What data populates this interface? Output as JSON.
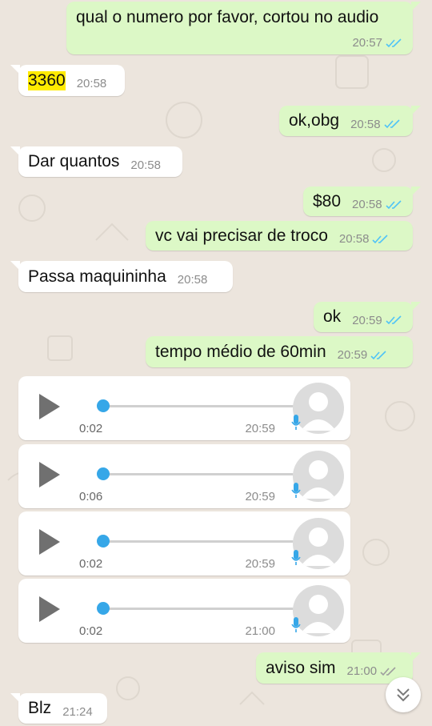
{
  "messages": [
    {
      "text": "qual o numero por favor, cortou no audio",
      "time": "20:57"
    },
    {
      "text": "3360",
      "time": "20:58"
    },
    {
      "text": "ok,obg",
      "time": "20:58"
    },
    {
      "text": "Dar quantos",
      "time": "20:58"
    },
    {
      "text": "$80",
      "time": "20:58"
    },
    {
      "text": "vc vai precisar de troco",
      "time": "20:58"
    },
    {
      "text": "Passa maquininha",
      "time": "20:58"
    },
    {
      "text": "ok",
      "time": "20:59"
    },
    {
      "text": "tempo médio de 60min",
      "time": "20:59"
    },
    {
      "text": "aviso sim",
      "time": "21:00"
    },
    {
      "text": "Blz",
      "time": "21:24"
    }
  ],
  "voice_notes": [
    {
      "duration": "0:02",
      "time": "20:59"
    },
    {
      "duration": "0:06",
      "time": "20:59"
    },
    {
      "duration": "0:02",
      "time": "20:59"
    },
    {
      "duration": "0:02",
      "time": "21:00"
    }
  ],
  "colors": {
    "outgoing_bubble": "#dcf8c6",
    "incoming_bubble": "#ffffff",
    "read_ticks": "#4fc3f7",
    "delivered_ticks": "#9e9e9e",
    "highlight": "#ffeb00",
    "audio_accent": "#36a7e8"
  },
  "icons": {
    "play": "play-icon",
    "mic": "mic-icon",
    "avatar": "avatar-icon",
    "scroll": "double-chevron-down-icon",
    "ticks": "double-check-icon"
  }
}
